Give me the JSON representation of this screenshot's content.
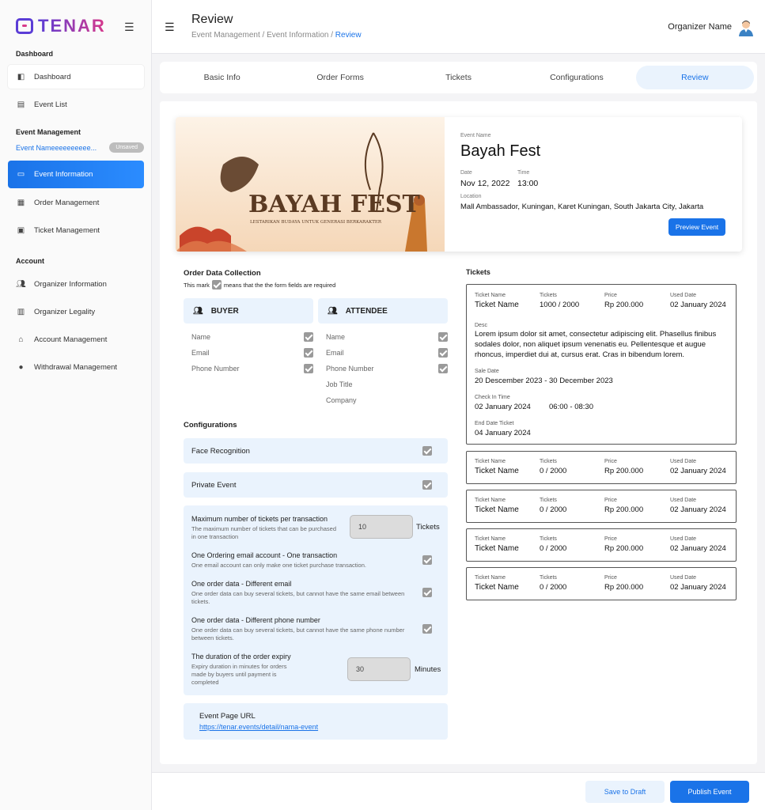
{
  "app": {
    "logo_text": "TENAR"
  },
  "sidebar": {
    "section_dashboard": "Dashboard",
    "dashboard": "Dashboard",
    "event_list": "Event List",
    "section_event": "Event Management",
    "draft_name": "Event Nameeeeeeeeee...",
    "draft_badge": "Unsaved",
    "event_information": "Event Information",
    "order_management": "Order Management",
    "ticket_management": "Ticket Management",
    "section_account": "Account",
    "organizer_information": "Organizer Information",
    "organizer_legality": "Organizer Legality",
    "account_management": "Account Management",
    "withdrawal_management": "Withdrawal Management"
  },
  "header": {
    "title": "Review",
    "crumb1": "Event Management",
    "crumb2": "Event Information",
    "crumb3": "Review",
    "sep": " / ",
    "organizer": "Organizer Name"
  },
  "tabs": [
    "Basic Info",
    "Order Forms",
    "Tickets",
    "Configurations",
    "Review"
  ],
  "event": {
    "name_label": "Event Name",
    "name": "Bayah Fest",
    "date_label": "Date",
    "date": "Nov 12, 2022",
    "time_label": "Time",
    "time": "13:00",
    "location_label": "Location",
    "location": "Mall Ambassador, Kuningan, Karet Kuningan, South Jakarta City, Jakarta",
    "preview_button": "Preview Event",
    "banner_title": "BAYAH FEST",
    "banner_sub": "LESTARIKAN BUDAYA UNTUK GENERASI BERKARAKTER"
  },
  "order_data": {
    "title": "Order Data Collection",
    "note_pre": "This mark",
    "note_post": "means that the the form fields are required",
    "buyer_title": "BUYER",
    "buyer_fields": [
      "Name",
      "Email",
      "Phone Number"
    ],
    "attendee_title": "ATTENDEE",
    "attendee_fields": [
      "Name",
      "Email",
      "Phone Number",
      "Job Title",
      "Company"
    ]
  },
  "configurations": {
    "title": "Configurations",
    "face_recognition": "Face Recognition",
    "private_event": "Private Event",
    "max_tickets_title": "Maximum number of tickets per transaction",
    "max_tickets_desc": "The maximum number of tickets that can be purchased in one transaction",
    "max_tickets_value": "10",
    "max_tickets_unit": "Tickets",
    "one_email_title": "One Ordering email account - One transaction",
    "one_email_desc": "One email account can only make one ticket purchase transaction.",
    "diff_email_title": "One order data - Different email",
    "diff_email_desc": "One order data can buy several tickets, but cannot have the same email between tickets.",
    "diff_phone_title": "One order data - Different phone number",
    "diff_phone_desc": "One order data can buy several tickets, but cannot have the same phone number between tickets.",
    "expiry_title": "The duration of the order expiry",
    "expiry_desc": "Expiry duration in minutes for orders made by buyers until payment is completed",
    "expiry_value": "30",
    "expiry_unit": "Minutes"
  },
  "url": {
    "title": "Event Page URL",
    "link": "https://tenar.events/detail/nama-event"
  },
  "tickets": {
    "title": "Tickets",
    "labels": {
      "name": "Ticket Name",
      "tickets": "Tickets",
      "price": "Price",
      "used": "Used Date",
      "desc": "Desc",
      "sale": "Sale Date",
      "checkin": "Check In Time",
      "end": "End Date Ticket"
    },
    "first": {
      "name": "Ticket Name",
      "tickets": "1000 / 2000",
      "price": "Rp 200.000",
      "used": "02 January 2024",
      "desc": "Lorem ipsum dolor sit amet, consectetur adipiscing elit. Phasellus finibus sodales dolor, non aliquet ipsum venenatis eu. Pellentesque et augue rhoncus, imperdiet dui at, cursus erat. Cras in bibendum lorem.",
      "sale": "20 Descember 2023 - 30 December 2023",
      "checkin_date": "02 January 2024",
      "checkin_time": "06:00 - 08:30",
      "end": "04 January 2024"
    },
    "rest": [
      {
        "name": "Ticket Name",
        "tickets": "0 / 2000",
        "price": "Rp 200.000",
        "used": "02 January 2024"
      },
      {
        "name": "Ticket Name",
        "tickets": "0 / 2000",
        "price": "Rp 200.000",
        "used": "02 January 2024"
      },
      {
        "name": "Ticket Name",
        "tickets": "0 / 2000",
        "price": "Rp 200.000",
        "used": "02 January 2024"
      },
      {
        "name": "Ticket Name",
        "tickets": "0 / 2000",
        "price": "Rp 200.000",
        "used": "02 January 2024"
      }
    ]
  },
  "footer": {
    "draft": "Save to Draft",
    "publish": "Publish Event"
  },
  "colors": {
    "primary": "#1a73e8",
    "light_blue": "#eaf3fd",
    "brand_purple": "#5b3dd6",
    "brand_pink": "#d8398a"
  }
}
